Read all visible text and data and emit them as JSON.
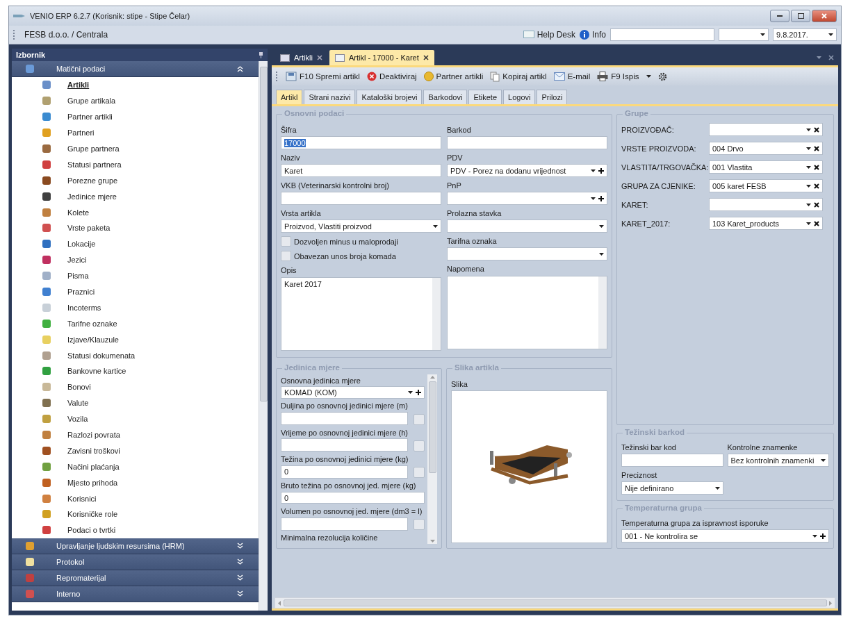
{
  "window": {
    "title": "VENIO ERP 6.2.7 (Korisnik: stipe - Stipe Čelar)"
  },
  "toolbar": {
    "company": "FESB d.o.o. / Centrala",
    "help_desk": "Help Desk",
    "info": "Info",
    "date": "9.8.2017."
  },
  "sidebar": {
    "title": "Izbornik",
    "groups": [
      {
        "label": "Matični podaci",
        "expanded": true,
        "items": [
          {
            "label": "Artikli",
            "selected": true
          },
          {
            "label": "Grupe artikala",
            "selected": false
          },
          {
            "label": "Partner artikli",
            "selected": false
          },
          {
            "label": "Partneri",
            "selected": false
          },
          {
            "label": "Grupe partnera",
            "selected": false
          },
          {
            "label": "Statusi partnera",
            "selected": false
          },
          {
            "label": "Porezne grupe",
            "selected": false
          },
          {
            "label": "Jedinice mjere",
            "selected": false
          },
          {
            "label": "Kolete",
            "selected": false
          },
          {
            "label": "Vrste paketa",
            "selected": false
          },
          {
            "label": "Lokacije",
            "selected": false
          },
          {
            "label": "Jezici",
            "selected": false
          },
          {
            "label": "Pisma",
            "selected": false
          },
          {
            "label": "Praznici",
            "selected": false
          },
          {
            "label": "Incoterms",
            "selected": false
          },
          {
            "label": "Tarifne oznake",
            "selected": false
          },
          {
            "label": "Izjave/Klauzule",
            "selected": false
          },
          {
            "label": "Statusi dokumenata",
            "selected": false
          },
          {
            "label": "Bankovne kartice",
            "selected": false
          },
          {
            "label": "Bonovi",
            "selected": false
          },
          {
            "label": "Valute",
            "selected": false
          },
          {
            "label": "Vozila",
            "selected": false
          },
          {
            "label": "Razlozi povrata",
            "selected": false
          },
          {
            "label": "Zavisni troškovi",
            "selected": false
          },
          {
            "label": "Načini plaćanja",
            "selected": false
          },
          {
            "label": "Mjesto prihoda",
            "selected": false
          },
          {
            "label": "Korisnici",
            "selected": false
          },
          {
            "label": "Korisničke role",
            "selected": false
          },
          {
            "label": "Podaci o tvrtki",
            "selected": false
          }
        ]
      },
      {
        "label": "Upravljanje ljudskim resursima (HRM)",
        "expanded": false
      },
      {
        "label": "Protokol",
        "expanded": false
      },
      {
        "label": "Repromaterijal",
        "expanded": false
      },
      {
        "label": "Interno",
        "expanded": false
      }
    ]
  },
  "doc_tabs": [
    {
      "label": "Artikli",
      "selected": false
    },
    {
      "label": "Artikl - 17000 - Karet",
      "selected": true
    }
  ],
  "actions": [
    "F10 Spremi artikl",
    "Deaktiviraj",
    "Partner artikli",
    "Kopiraj artikl",
    "E-mail",
    "F9 Ispis"
  ],
  "form_tabs": [
    {
      "label": "Artikl",
      "selected": true
    },
    {
      "label": "Strani nazivi",
      "selected": false
    },
    {
      "label": "Kataloški brojevi",
      "selected": false
    },
    {
      "label": "Barkodovi",
      "selected": false
    },
    {
      "label": "Etikete",
      "selected": false
    },
    {
      "label": "Logovi",
      "selected": false
    },
    {
      "label": "Prilozi",
      "selected": false
    }
  ],
  "osnovni_podaci": {
    "title": "Osnovni podaci",
    "left": [
      {
        "kind": "text",
        "label": "Šifra",
        "value": "17000",
        "value_selected": true
      },
      {
        "kind": "text",
        "label": "Naziv",
        "value": "Karet"
      },
      {
        "kind": "text",
        "label": "VKB (Veterinarski kontrolni broj)"
      },
      {
        "kind": "combo",
        "label": "Vrsta artikla",
        "value": "Proizvod, Vlastiti proizvod"
      },
      {
        "kind": "checkbox",
        "label": "Dozvoljen minus u maloprodaji",
        "checked": false
      },
      {
        "kind": "checkbox",
        "label": "Obavezan unos broja komada",
        "checked": false
      },
      {
        "kind": "textarea",
        "label": "Opis",
        "value": "Karet 2017"
      }
    ],
    "right": [
      {
        "kind": "text",
        "label": "Barkod"
      },
      {
        "kind": "combo_add",
        "label": "PDV",
        "value": "PDV - Porez na dodanu vrijednost"
      },
      {
        "kind": "combo_add",
        "label": "PnP"
      },
      {
        "kind": "combo",
        "label": "Prolazna stavka"
      },
      {
        "kind": "combo",
        "label": "Tarifna oznaka"
      },
      {
        "kind": "textarea",
        "label": "Napomena"
      }
    ]
  },
  "jedinica_mjere": {
    "title": "Jedinica mjere",
    "fields": [
      {
        "kind": "combo_add",
        "label": "Osnovna jedinica mjere",
        "value": "KOMAD (KOM)"
      },
      {
        "kind": "text_btn",
        "label": "Duljina po osnovnoj jedinici mjere (m)"
      },
      {
        "kind": "text_btn",
        "label": "Vrijeme po osnovnoj jedinici mjere (h)"
      },
      {
        "kind": "text_btn",
        "label": "Težina po osnovnoj jedinici mjere (kg)",
        "value": "0"
      },
      {
        "kind": "text",
        "label": "Bruto težina po osnovnoj jed. mjere (kg)",
        "value": "0"
      },
      {
        "kind": "text_btn",
        "label": "Volumen po osnovnoj jed. mjere (dm3 = l)"
      },
      {
        "kind": "label",
        "label": "Minimalna rezolucija količine"
      }
    ]
  },
  "slika": {
    "title": "Slika artikla",
    "label": "Slika"
  },
  "grupe": {
    "title": "Grupe",
    "rows": [
      {
        "label": "PROIZVOĐAČ:"
      },
      {
        "label": "VRSTE PROIZVODA:",
        "value": "004 Drvo"
      },
      {
        "label": "VLASTITA/TRGOVAČKA:",
        "value": "001 Vlastita"
      },
      {
        "label": "GRUPA ZA CJENIKE:",
        "value": "005 karet FESB"
      },
      {
        "label": "KARET:"
      },
      {
        "label": "KARET_2017:",
        "value": "103 Karet_products"
      }
    ]
  },
  "tezinski_barkod": {
    "title": "Težinski barkod",
    "fields": [
      {
        "kind": "text",
        "label": "Težinski bar kod"
      },
      {
        "kind": "combo",
        "label": "Kontrolne znamenke",
        "value": "Bez kontrolnih znamenki"
      },
      {
        "kind": "combo",
        "label": "Preciznost",
        "value": "Nije definirano"
      }
    ]
  },
  "temperaturna_grupa": {
    "title": "Temperaturna grupa",
    "fields": [
      {
        "kind": "combo_add",
        "label": "Temperaturna grupa za ispravnost isporuke",
        "value": "001 - Ne kontrolira se"
      }
    ]
  }
}
